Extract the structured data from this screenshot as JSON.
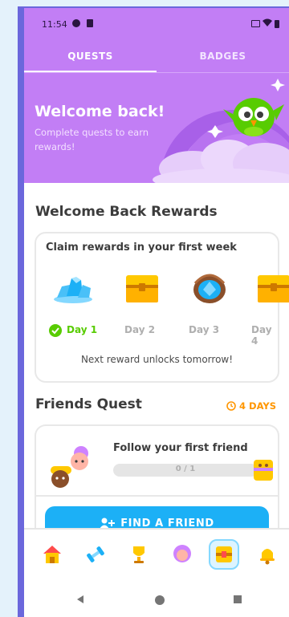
{
  "status": {
    "time": "11:54"
  },
  "tabs": [
    {
      "label": "QUESTS",
      "active": true
    },
    {
      "label": "BADGES",
      "active": false
    }
  ],
  "hero": {
    "title": "Welcome back!",
    "subtitle": "Complete quests to earn rewards!"
  },
  "welcome_rewards": {
    "title": "Welcome Back Rewards",
    "card_title": "Claim rewards in your first week",
    "days": [
      {
        "label": "Day 1",
        "reward": "gems-icon",
        "claimed": true
      },
      {
        "label": "Day 2",
        "reward": "chest-icon",
        "claimed": false
      },
      {
        "label": "Day 3",
        "reward": "gem-basket-icon",
        "claimed": false
      },
      {
        "label": "Day 4",
        "reward": "chest-icon",
        "claimed": false
      }
    ],
    "note": "Next reward unlocks tomorrow!"
  },
  "friends_quest": {
    "title": "Friends Quest",
    "time_left": "4 DAYS",
    "task": "Follow your first friend",
    "progress_text": "0 / 1",
    "progress": 0,
    "button": "FIND A FRIEND"
  },
  "bottom_nav": [
    {
      "icon": "home-icon",
      "active": false
    },
    {
      "icon": "dumbbell-icon",
      "active": false
    },
    {
      "icon": "trophy-icon",
      "active": false
    },
    {
      "icon": "profile-icon",
      "active": false
    },
    {
      "icon": "quests-chest-icon",
      "active": true
    },
    {
      "icon": "bell-icon",
      "active": false
    }
  ],
  "colors": {
    "header": "#c27ef5",
    "accent_green": "#58cc02",
    "accent_blue": "#1cb0f6",
    "accent_orange": "#ff9600",
    "frame": "#6b67dc"
  }
}
